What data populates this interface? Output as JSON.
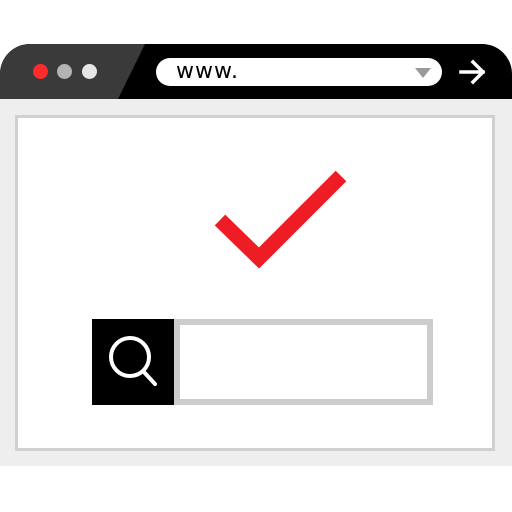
{
  "browser": {
    "address_bar": {
      "value": "www."
    }
  },
  "search": {
    "value": "",
    "placeholder": ""
  },
  "icons": {
    "window_controls": [
      "close-dot-icon",
      "minimize-dot-icon",
      "maximize-dot-icon"
    ],
    "dropdown": "triangle-down-icon",
    "go": "arrow-right-icon",
    "search": "magnifier-icon",
    "status": "checkmark-icon"
  },
  "colors": {
    "title_bar": "#000000",
    "title_bar_left": "#3a3a3a",
    "dot_red": "#ff2a2a",
    "dot_gray1": "#b3b3b3",
    "dot_gray2": "#e6e6e6",
    "check": "#ee1c24",
    "content_bg": "#eeeeee",
    "field_border": "#cccccc"
  }
}
